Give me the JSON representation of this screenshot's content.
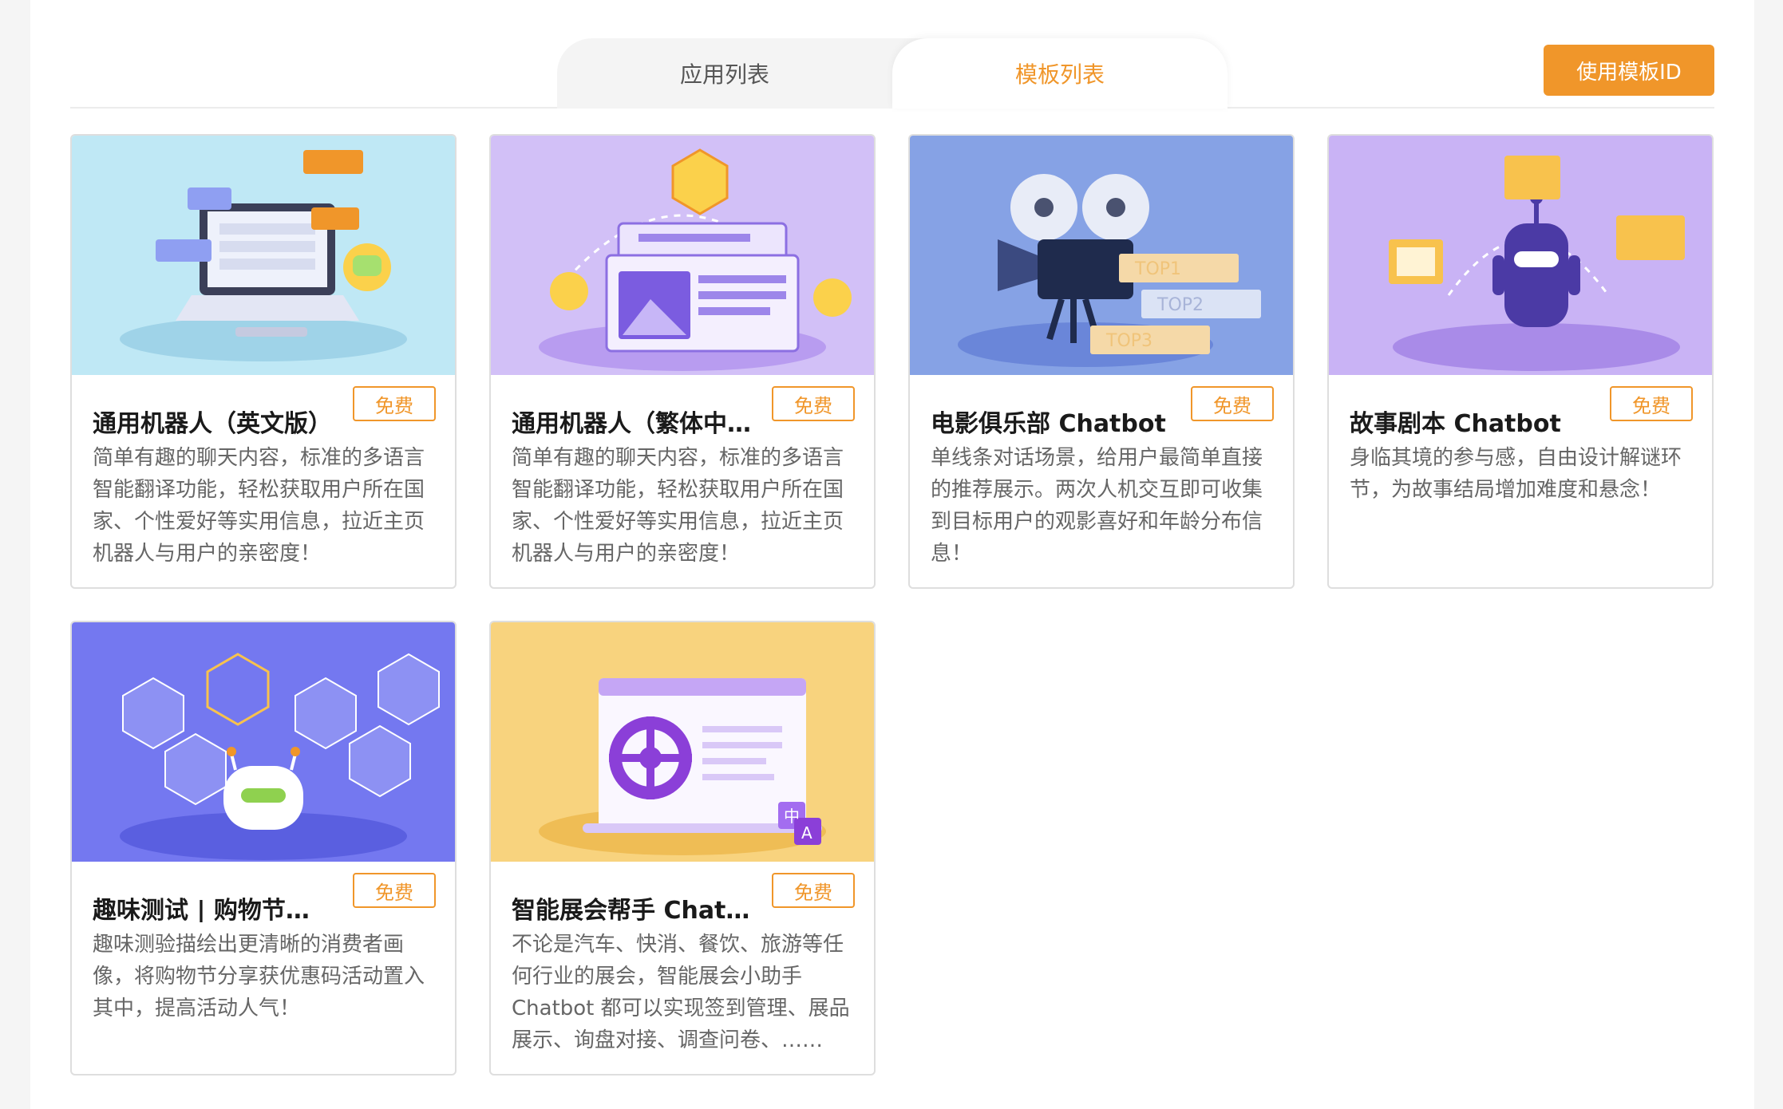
{
  "tabs": [
    {
      "label": "应用列表"
    },
    {
      "label": "模板列表"
    }
  ],
  "use_template_button": "使用模板ID",
  "accent_color": "#f0962a",
  "cards": [
    {
      "title": "通用机器人（英文版）",
      "badge": "免费",
      "description": "简单有趣的聊天内容，标准的多语言智能翻译功能，轻松获取用户所在国家、个性爱好等实用信息，拉近主页机器人与用户的亲密度！",
      "thumb_bg": "#bfe8f5",
      "illustration": "laptop-chat-illustration"
    },
    {
      "title": "通用机器人（繁体中文版）",
      "badge": "免费",
      "description": "简单有趣的聊天内容，标准的多语言智能翻译功能，轻松获取用户所在国家、个性爱好等实用信息，拉近主页机器人与用户的亲密度！",
      "thumb_bg": "#d2c0f7",
      "illustration": "profile-card-illustration"
    },
    {
      "title": "电影俱乐部 Chatbot",
      "badge": "免费",
      "description": "单线条对话场景，给用户最简单直接的推荐展示。两次人机交互即可收集到目标用户的观影喜好和年龄分布信息！",
      "thumb_bg": "#86a2e5",
      "illustration": "movie-projector-illustration",
      "ranks": [
        "TOP1",
        "TOP2",
        "TOP3"
      ]
    },
    {
      "title": "故事剧本 Chatbot",
      "badge": "免费",
      "description": "身临其境的参与感，自由设计解谜环节，为故事结局增加难度和悬念！",
      "thumb_bg": "#c9b3f5",
      "illustration": "story-robot-illustration"
    },
    {
      "title": "趣味测试 | 购物节优惠码",
      "badge": "免费",
      "description": "趣味测验描绘出更清晰的消费者画像，将购物节分享获优惠码活动置入其中，提高活动人气！",
      "thumb_bg": "#7478f0",
      "illustration": "game-robot-illustration"
    },
    {
      "title": "智能展会帮手 Chatbot",
      "badge": "免费",
      "description": "不论是汽车、快消、餐饮、旅游等任何行业的展会，智能展会小助手 Chatbot 都可以实现签到管理、展品展示、询盘对接、调查问卷、……",
      "thumb_bg": "#f8d37e",
      "illustration": "wheel-window-illustration",
      "lang_badges": [
        "中",
        "A"
      ]
    }
  ]
}
